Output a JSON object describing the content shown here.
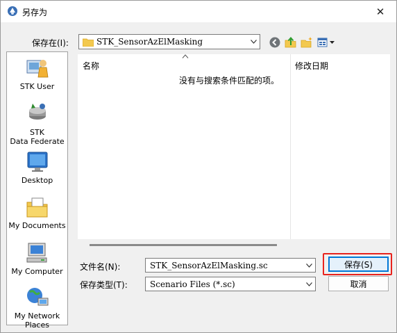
{
  "window": {
    "title": "另存为",
    "close_glyph": "✕"
  },
  "save_in": {
    "label": "保存在(I):",
    "value": "STK_SensorAzElMasking"
  },
  "toolbar": {
    "back_icon": "back-arrow-icon",
    "up_icon": "up-folder-icon",
    "new_folder_icon": "new-folder-icon",
    "view_icon": "view-menu-icon"
  },
  "places": [
    {
      "label": "STK User",
      "icon": "stk-user-icon"
    },
    {
      "label": "STK\nData Federate",
      "icon": "data-federate-icon"
    },
    {
      "label": "Desktop",
      "icon": "desktop-icon"
    },
    {
      "label": "My Documents",
      "icon": "my-documents-icon"
    },
    {
      "label": "My Computer",
      "icon": "my-computer-icon"
    },
    {
      "label": "My Network\nPlaces",
      "icon": "my-network-places-icon"
    }
  ],
  "file_list": {
    "columns": [
      "名称",
      "修改日期"
    ],
    "empty_message": "没有与搜索条件匹配的项。"
  },
  "file_name": {
    "label": "文件名(N):",
    "value": "STK_SensorAzElMasking.sc"
  },
  "file_type": {
    "label": "保存类型(T):",
    "value": "Scenario Files (*.sc)"
  },
  "buttons": {
    "save": "保存(S)",
    "cancel": "取消"
  },
  "colors": {
    "highlight": "#e8231d",
    "accent": "#0078d7"
  }
}
